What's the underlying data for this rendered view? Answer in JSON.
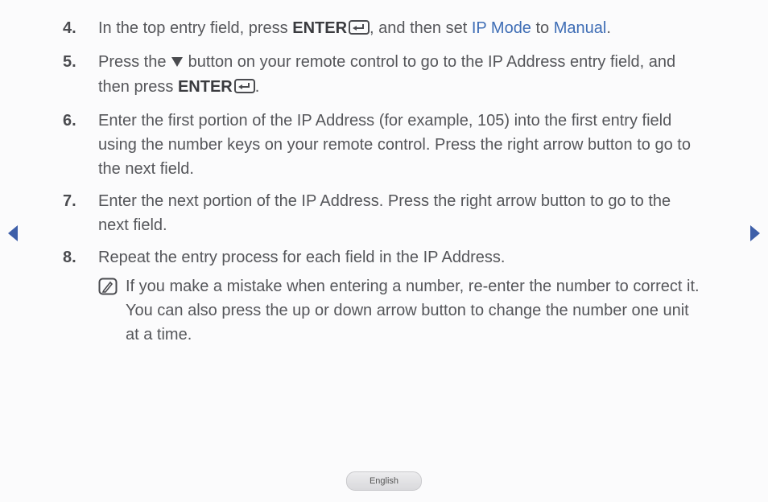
{
  "steps": [
    {
      "num": "4.",
      "parts": [
        {
          "t": "text",
          "v": "In the top entry field, press "
        },
        {
          "t": "bold",
          "v": "ENTER"
        },
        {
          "t": "enter-icon"
        },
        {
          "t": "text",
          "v": ", and then set "
        },
        {
          "t": "link",
          "v": "IP Mode"
        },
        {
          "t": "text",
          "v": " to "
        },
        {
          "t": "link",
          "v": "Manual"
        },
        {
          "t": "text",
          "v": "."
        }
      ]
    },
    {
      "num": "5.",
      "parts": [
        {
          "t": "text",
          "v": "Press the "
        },
        {
          "t": "down-triangle"
        },
        {
          "t": "text",
          "v": " button on your remote control to go to the IP Address entry field, and then press "
        },
        {
          "t": "bold",
          "v": "ENTER"
        },
        {
          "t": "enter-icon"
        },
        {
          "t": "text",
          "v": "."
        }
      ]
    },
    {
      "num": "6.",
      "parts": [
        {
          "t": "text",
          "v": "Enter the first portion of the IP Address (for example, 105) into the first entry field using the number keys on your remote control. Press the right arrow button to go to the next field."
        }
      ]
    },
    {
      "num": "7.",
      "parts": [
        {
          "t": "text",
          "v": "Enter the next portion of the IP Address. Press the right arrow button to go to the next field."
        }
      ]
    },
    {
      "num": "8.",
      "parts": [
        {
          "t": "text",
          "v": "Repeat the entry process for each field in the IP Address."
        }
      ],
      "note": "If you make a mistake when entering a number, re-enter the number to correct it. You can also press the up or down arrow button to change the number one unit at a time."
    }
  ],
  "language_label": "English"
}
